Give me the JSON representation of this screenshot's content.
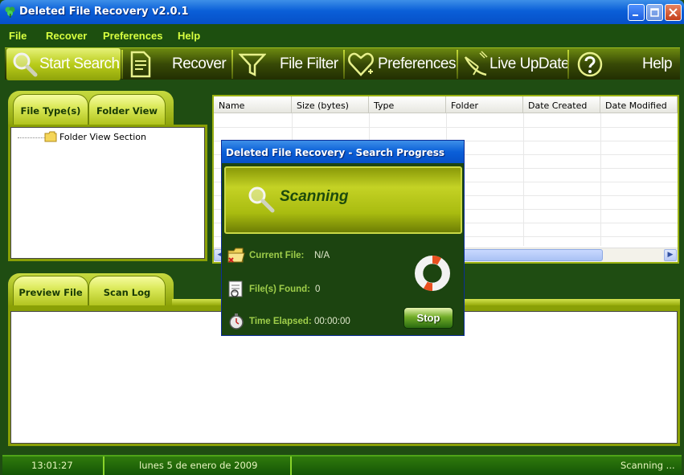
{
  "window": {
    "title": "Deleted File Recovery v2.0.1"
  },
  "menu": [
    "File",
    "Recover",
    "Preferences",
    "Help"
  ],
  "toolbar": {
    "start_search": "Start Search",
    "recover": "Recover",
    "file_filter": "File Filter",
    "preferences": "Preferences",
    "live_update": "Live UpDate",
    "help": "Help"
  },
  "tabs_top": {
    "file_types": "File Type(s)",
    "folder_view": "Folder View"
  },
  "tree": {
    "root": "Folder View Section"
  },
  "file_table": {
    "columns": [
      "Name",
      "Size (bytes)",
      "Type",
      "Folder",
      "Date Created",
      "Date Modified"
    ]
  },
  "tabs_bottom": {
    "preview_file": "Preview File",
    "scan_log": "Scan Log"
  },
  "dialog": {
    "title": "Deleted File Recovery - Search Progress",
    "banner": "Scanning",
    "current_file_label": "Current File:",
    "current_file_value": "N/A",
    "files_found_label": "File(s) Found:",
    "files_found_value": "0",
    "time_elapsed_label": "Time Elapsed:",
    "time_elapsed_value": "00:00:00",
    "stop": "Stop"
  },
  "status": {
    "time": "13:01:27",
    "date": "lunes 5 de enero de 2009",
    "state": "Scanning ..."
  },
  "colors": {
    "accent": "#d8ff40",
    "background": "#1f4d12",
    "titlebar": "#0a5fd8"
  }
}
